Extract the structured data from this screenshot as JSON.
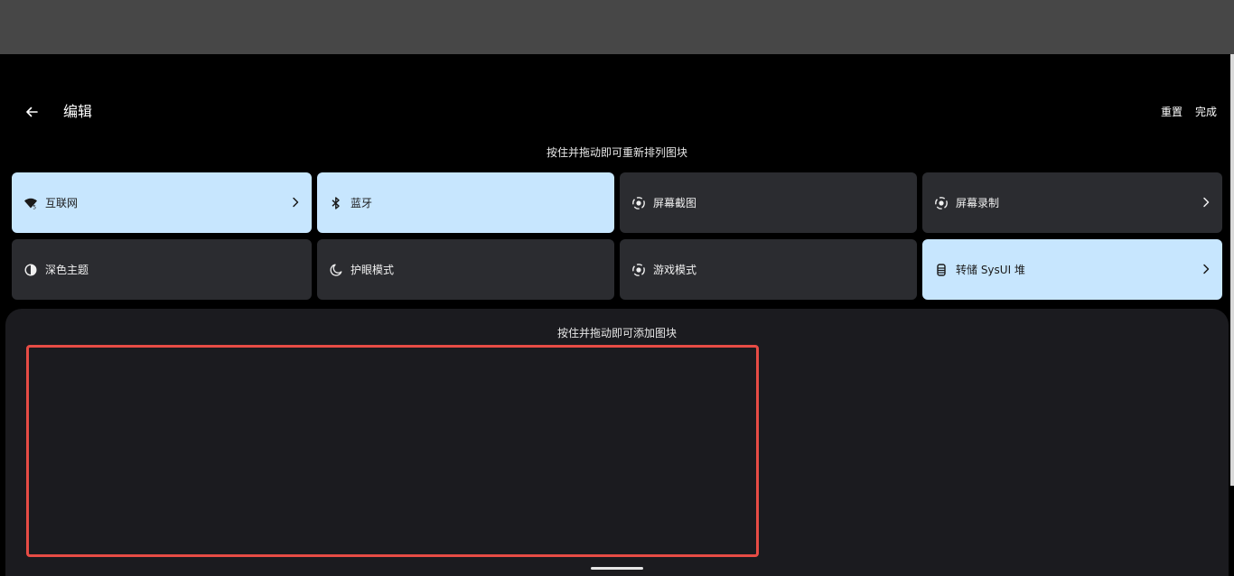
{
  "header": {
    "back_icon": "arrow-left-icon",
    "title": "编辑",
    "reset_label": "重置",
    "done_label": "完成"
  },
  "hints": {
    "rearrange": "按住并拖动即可重新排列图块",
    "add": "按住并拖动即可添加图块"
  },
  "tiles": [
    {
      "label": "互联网",
      "icon": "wifi-icon",
      "active": true,
      "has_chevron": true
    },
    {
      "label": "蓝牙",
      "icon": "bluetooth-icon",
      "active": true,
      "has_chevron": false
    },
    {
      "label": "屏幕截图",
      "icon": "screenshot-icon",
      "active": false,
      "has_chevron": false
    },
    {
      "label": "屏幕录制",
      "icon": "screen-record-icon",
      "active": false,
      "has_chevron": true
    },
    {
      "label": "深色主题",
      "icon": "dark-theme-icon",
      "active": false,
      "has_chevron": false
    },
    {
      "label": "护眼模式",
      "icon": "moon-icon",
      "active": false,
      "has_chevron": false
    },
    {
      "label": "游戏模式",
      "icon": "game-mode-icon",
      "active": false,
      "has_chevron": false
    },
    {
      "label": "转储 SysUI 堆",
      "icon": "dump-heap-icon",
      "active": true,
      "has_chevron": true
    }
  ],
  "colors": {
    "tile_active": "#c7e6fe",
    "tile_inactive": "#2b2c30",
    "highlight": "#e74c45",
    "panel": "#1b1b1f"
  }
}
